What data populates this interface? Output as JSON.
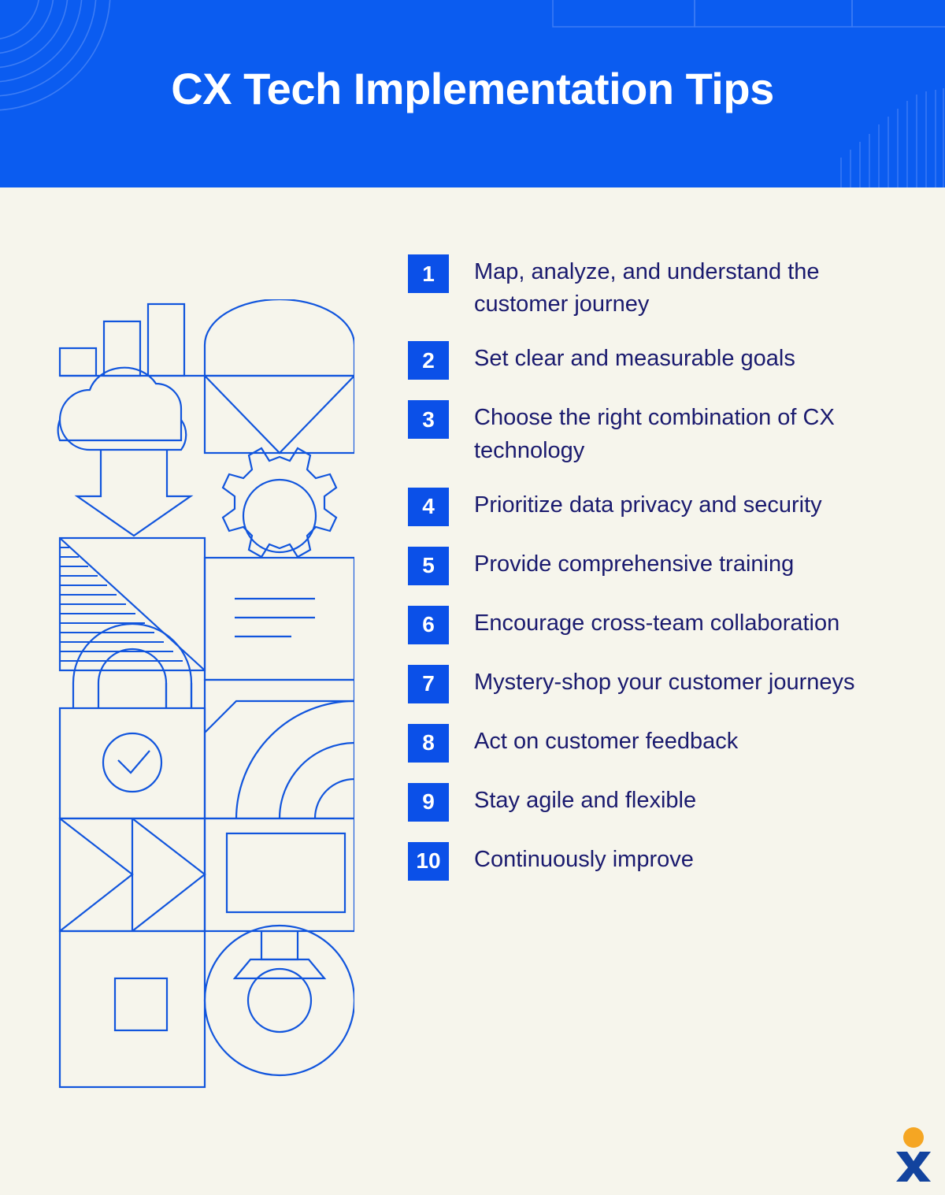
{
  "theme": {
    "header_bg": "#0B5CF0",
    "page_bg": "#F6F5EC",
    "accent_blue": "#0B50E8",
    "text_navy": "#1A1A6E",
    "line_blue": "#1155DD",
    "logo_dot": "#F5A623",
    "logo_x": "#12439E"
  },
  "header": {
    "title": "CX Tech Implementation Tips"
  },
  "illustration": {
    "alt": "geometric line illustration column",
    "icons": [
      "bar-chart-icon",
      "envelope-arch-icon",
      "cloud-download-icon",
      "gear-icon",
      "striped-triangle-icon",
      "document-lines-icon",
      "padlock-check-icon",
      "wifi-arcs-icon",
      "play-triangles-icon",
      "monitor-icon",
      "square-in-square-icon",
      "donut-circle-icon"
    ]
  },
  "tips": [
    {
      "number": "1",
      "text": "Map, analyze, and understand the customer journey"
    },
    {
      "number": "2",
      "text": "Set clear and measurable goals"
    },
    {
      "number": "3",
      "text": "Choose the right combination of CX technology"
    },
    {
      "number": "4",
      "text": "Prioritize data privacy and security"
    },
    {
      "number": "5",
      "text": "Provide comprehensive training"
    },
    {
      "number": "6",
      "text": "Encourage cross-team collaboration"
    },
    {
      "number": "7",
      "text": "Mystery-shop your customer journeys"
    },
    {
      "number": "8",
      "text": "Act on customer feedback"
    },
    {
      "number": "9",
      "text": "Stay agile and flexible"
    },
    {
      "number": "10",
      "text": "Continuously improve"
    }
  ],
  "logo": {
    "name": "xm-logo"
  }
}
